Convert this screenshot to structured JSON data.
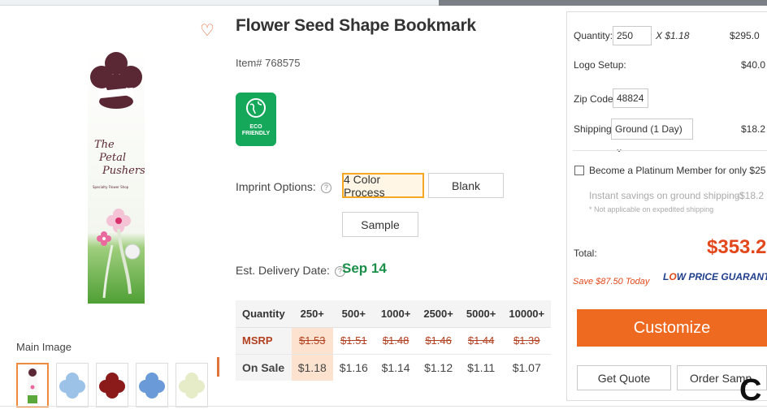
{
  "product": {
    "title": "Flower Seed Shape Bookmark",
    "item_number": "Item# 768575",
    "eco_badge": "ECO FRIENDLY",
    "main_image_label": "Main Image",
    "bookmark_text": [
      "The",
      "Petal",
      "Pushers"
    ],
    "bookmark_subtext": "Specialty Flower Shop",
    "thumbnails": [
      {
        "color": "#f2f2f2",
        "name": "thumb-bookmark"
      },
      {
        "color": "#9cc2e8",
        "name": "thumb-light-blue"
      },
      {
        "color": "#8b1a1a",
        "name": "thumb-maroon"
      },
      {
        "color": "#6a9ad8",
        "name": "thumb-blue"
      },
      {
        "color": "#e6ecc8",
        "name": "thumb-cream"
      }
    ]
  },
  "imprint": {
    "label": "Imprint Options:",
    "options": [
      "4 Color Process",
      "Blank",
      "Sample"
    ],
    "selected": "4 Color Process"
  },
  "delivery": {
    "label": "Est. Delivery Date:",
    "date": "Sep 14"
  },
  "pricing": {
    "header": [
      "Quantity",
      "250+",
      "500+",
      "1000+",
      "2500+",
      "5000+",
      "10000+"
    ],
    "msrp_label": "MSRP",
    "msrp": [
      "$1.53",
      "$1.51",
      "$1.48",
      "$1.46",
      "$1.44",
      "$1.39"
    ],
    "sale_label": "On Sale",
    "sale": [
      "$1.18",
      "$1.16",
      "$1.14",
      "$1.12",
      "$1.11",
      "$1.07"
    ]
  },
  "cart": {
    "quantity_label": "Quantity:",
    "quantity_value": "250",
    "unit_price": "X $1.18",
    "quantity_total": "$295.0",
    "logo_label": "Logo Setup:",
    "logo_total": "$40.0",
    "zip_label": "Zip Code:",
    "zip_value": "48824",
    "shipping_label": "Shipping:",
    "shipping_value": "Ground (1 Day)",
    "shipping_total": "$18.2",
    "platinum_label": "Become a Platinum Member for only $25",
    "instant_savings": "Instant savings on ground shipping:",
    "instant_savings_value": "-$18.2",
    "not_applicable": "* Not applicable on expedited shipping",
    "total_label": "Total:",
    "total_value": "$353.2",
    "save_text": "Save $87.50 Today",
    "guarantee_l": "L",
    "guarantee_o": "O",
    "guarantee_rest": "W PRICE GUARANTE",
    "customize_label": "Customize",
    "quote_label": "Get Quote",
    "sample_label": "Order Samp",
    "corner_letter": "C"
  },
  "colors": {
    "accent_orange": "#ef6a21",
    "sale_red": "#e2481b",
    "eco_green": "#15a85a",
    "delivery_green": "#1a8f4a",
    "guarantee_blue": "#1f3e8c",
    "highlight_peach": "#fde3cf"
  }
}
